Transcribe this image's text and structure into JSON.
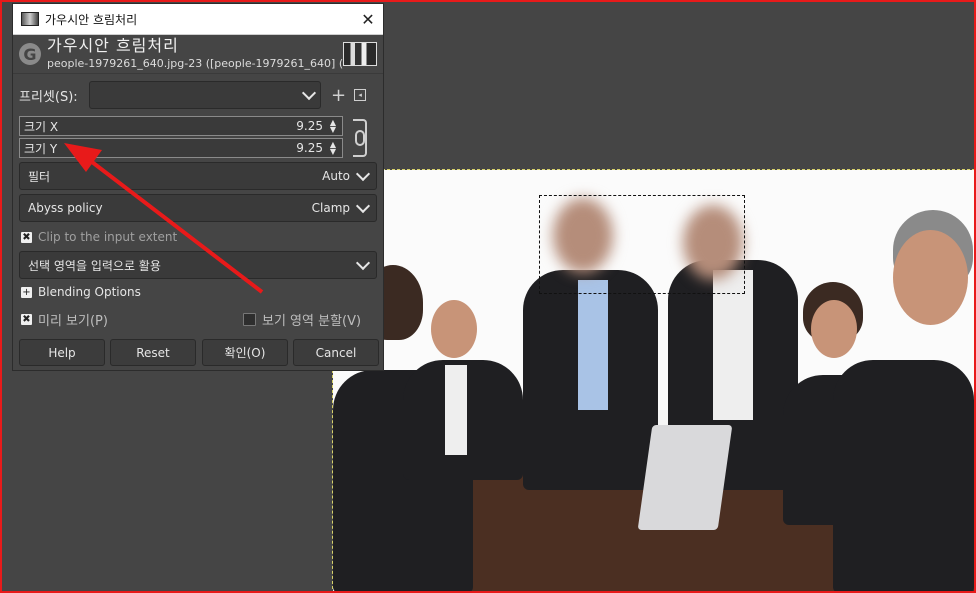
{
  "dialog": {
    "window_title": "가우시안 흐림처리",
    "close_glyph": "✕",
    "header_title": "가우시안 흐림처리",
    "header_subtitle": "people-1979261_640.jpg-23 ([people-1979261_640] (가…",
    "logo_letter": "G"
  },
  "presets": {
    "label": "프리셋(S):",
    "value": "",
    "add_glyph": "+",
    "manage_glyph": "◂"
  },
  "size_x": {
    "label": "크기 X",
    "value": "9.25"
  },
  "size_y": {
    "label": "크기 Y",
    "value": "9.25"
  },
  "filter": {
    "label": "필터",
    "value": "Auto"
  },
  "abyss": {
    "label": "Abyss policy",
    "value": "Clamp"
  },
  "clip": {
    "label": "Clip to the input extent",
    "checked": true
  },
  "selection_mode": {
    "value": "선택 영역을 입력으로 활용"
  },
  "blending": {
    "label": "Blending Options"
  },
  "preview": {
    "label": "미리 보기(P)",
    "checked": true
  },
  "split_view": {
    "label": "보기 영역 분할(V)",
    "checked": false
  },
  "buttons": {
    "help": "Help",
    "reset": "Reset",
    "ok": "확인(O)",
    "cancel": "Cancel"
  },
  "colors": {
    "dialog_bg": "#454545",
    "annotation_red": "#e81a1a"
  }
}
